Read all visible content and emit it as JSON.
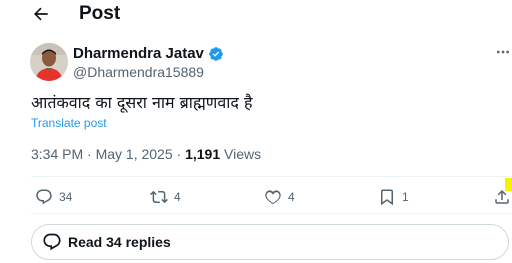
{
  "header": {
    "title": "Post"
  },
  "tweet": {
    "author_name": "Dharmendra Jatav",
    "author_handle": "@Dharmendra15889",
    "text": "आतंकवाद का दूसरा नाम ब्राह्मणवाद है",
    "translate_label": "Translate post",
    "timestamp": "3:34 PM · May 1, 2025 · ",
    "views_count": "1,191",
    "views_label": " Views"
  },
  "actions": {
    "reply_count": "34",
    "repost_count": "4",
    "like_count": "4",
    "bookmark_count": "1"
  },
  "replies": {
    "label": "Read 34 replies"
  },
  "icons": {
    "back": "arrow-left-icon",
    "verified": "verified-badge-icon",
    "more": "more-horizontal-icon",
    "reply": "reply-icon",
    "repost": "repost-icon",
    "like": "heart-icon",
    "bookmark": "bookmark-icon",
    "share": "share-icon",
    "replies": "speech-bubble-icon"
  },
  "colors": {
    "accent": "#1d9bf0",
    "text": "#0f1419",
    "secondary": "#536471",
    "border": "#cfd9de"
  }
}
